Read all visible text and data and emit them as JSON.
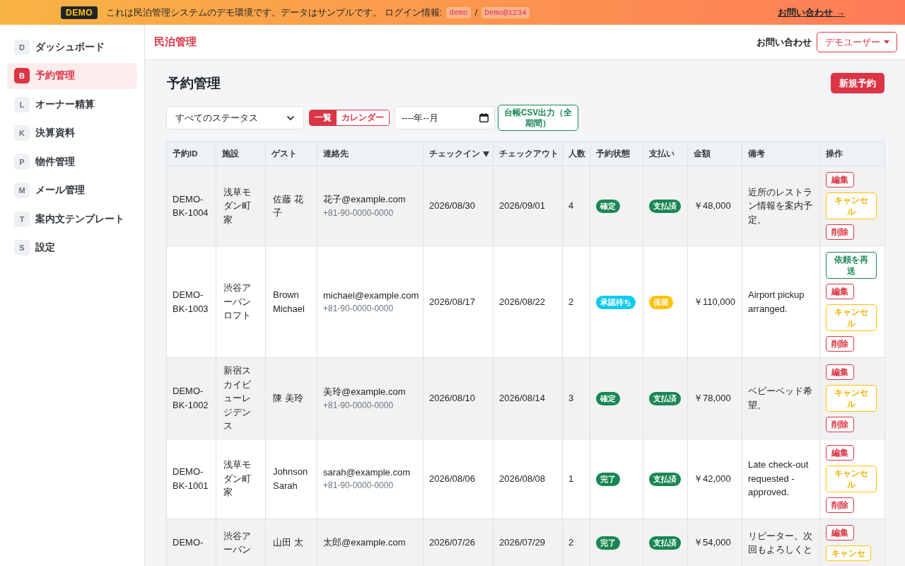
{
  "banner": {
    "badge": "DEMO",
    "message": "これは民泊管理システムのデモ環境です。データはサンプルです。 ログイン情報:",
    "login_id": "demo",
    "separator": "/",
    "password": "Demo@1234",
    "link": "お問い合わせ →"
  },
  "sidebar": {
    "items": [
      {
        "initial": "D",
        "label": "ダッシュボード",
        "selected": false
      },
      {
        "initial": "B",
        "label": "予約管理",
        "selected": true
      },
      {
        "initial": "L",
        "label": "オーナー精算",
        "selected": false
      },
      {
        "initial": "K",
        "label": "決算資料",
        "selected": false
      },
      {
        "initial": "P",
        "label": "物件管理",
        "selected": false
      },
      {
        "initial": "M",
        "label": "メール管理",
        "selected": false
      },
      {
        "initial": "T",
        "label": "案内文テンプレート",
        "selected": false
      },
      {
        "initial": "S",
        "label": "設定",
        "selected": false
      }
    ]
  },
  "header": {
    "brand": "民泊管理",
    "contact_link": "お問い合わせ",
    "user_menu": "デモユーザー"
  },
  "page": {
    "title": "予約管理",
    "new_button": "新規予約"
  },
  "toolbar": {
    "status_filter": "すべてのステータス",
    "view_tabs": [
      {
        "label": "一覧",
        "selected": true
      },
      {
        "label": "カレンダー",
        "selected": false
      }
    ],
    "month_field": {
      "placeholder": "----年--月"
    },
    "export_button": "台帳CSV出力（全期間）"
  },
  "table": {
    "columns": [
      {
        "label": "予約ID",
        "sorted": false
      },
      {
        "label": "施設",
        "sorted": false
      },
      {
        "label": "ゲスト",
        "sorted": false
      },
      {
        "label": "連絡先",
        "sorted": false
      },
      {
        "label": "チェックイン",
        "sorted": true
      },
      {
        "label": "チェックアウト",
        "sorted": false
      },
      {
        "label": "人数",
        "sorted": false
      },
      {
        "label": "予約状態",
        "sorted": false
      },
      {
        "label": "支払い",
        "sorted": false
      },
      {
        "label": "金額",
        "sorted": false
      },
      {
        "label": "備考",
        "sorted": false
      },
      {
        "label": "操作",
        "sorted": false
      }
    ],
    "rows": [
      {
        "id": "DEMO-BK-1004",
        "facility": "浅草モダン町家",
        "guest": "佐藤 花子",
        "email": "花子@example.com",
        "phone": "+81-90-0000-0000",
        "checkin": "2026/08/30",
        "checkout": "2026/09/01",
        "guests": "4",
        "status": {
          "label": "確定",
          "color": "#198754"
        },
        "payment": {
          "label": "支払済",
          "color": "#198754"
        },
        "amount": "￥48,000",
        "note": "近所のレストラン情報を案内予定。",
        "actions": [
          {
            "label": "編集",
            "kind": "edit"
          },
          {
            "label": "キャンセル",
            "kind": "cancel"
          },
          {
            "label": "削除",
            "kind": "delete"
          }
        ]
      },
      {
        "id": "DEMO-BK-1003",
        "facility": "渋谷アーバンロフト",
        "guest": "Brown Michael",
        "email": "michael@example.com",
        "phone": "+81-90-0000-0000",
        "checkin": "2026/08/17",
        "checkout": "2026/08/22",
        "guests": "2",
        "status": {
          "label": "承認待ち",
          "color": "#0dcaf0"
        },
        "payment": {
          "label": "保留",
          "color": "#ffc107"
        },
        "amount": "￥110,000",
        "note": "Airport pickup arranged.",
        "actions": [
          {
            "label": "依頼を再送",
            "kind": "resend"
          },
          {
            "label": "編集",
            "kind": "edit"
          },
          {
            "label": "キャンセル",
            "kind": "cancel"
          },
          {
            "label": "削除",
            "kind": "delete"
          }
        ]
      },
      {
        "id": "DEMO-BK-1002",
        "facility": "新宿スカイビューレジデンス",
        "guest": "陳 美玲",
        "email": "美玲@example.com",
        "phone": "+81-90-0000-0000",
        "checkin": "2026/08/10",
        "checkout": "2026/08/14",
        "guests": "3",
        "status": {
          "label": "確定",
          "color": "#198754"
        },
        "payment": {
          "label": "支払済",
          "color": "#198754"
        },
        "amount": "￥78,000",
        "note": "ベビーベッド希望。",
        "actions": [
          {
            "label": "編集",
            "kind": "edit"
          },
          {
            "label": "キャンセル",
            "kind": "cancel"
          },
          {
            "label": "削除",
            "kind": "delete"
          }
        ]
      },
      {
        "id": "DEMO-BK-1001",
        "facility": "浅草モダン町家",
        "guest": "Johnson Sarah",
        "email": "sarah@example.com",
        "phone": "+81-90-0000-0000",
        "checkin": "2026/08/06",
        "checkout": "2026/08/08",
        "guests": "1",
        "status": {
          "label": "完了",
          "color": "#198754"
        },
        "payment": {
          "label": "支払済",
          "color": "#198754"
        },
        "amount": "￥42,000",
        "note": "Late check-out requested - approved.",
        "actions": [
          {
            "label": "編集",
            "kind": "edit"
          },
          {
            "label": "キャンセル",
            "kind": "cancel"
          },
          {
            "label": "削除",
            "kind": "delete"
          }
        ]
      },
      {
        "id": "DEMO-",
        "facility": "渋谷アーバン",
        "guest": "山田 太",
        "email": "太郎@example.com",
        "checkin": "2026/07/26",
        "checkout": "2026/07/29",
        "guests": "2",
        "status": {
          "label": "完了",
          "color": "#198754"
        },
        "payment": {
          "label": "支払済",
          "color": "#198754"
        },
        "amount": "￥54,000",
        "note": "リピーター。次回もよろしくと",
        "actions": [
          {
            "label": "編集",
            "kind": "edit"
          },
          {
            "label": "キャンセ",
            "kind": "cancel"
          }
        ]
      }
    ]
  }
}
